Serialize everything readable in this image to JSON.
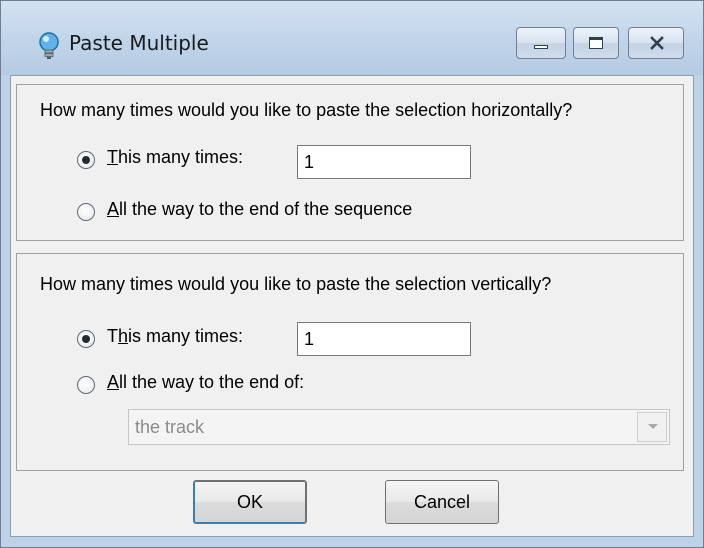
{
  "window": {
    "title": "Paste Multiple",
    "icons": {
      "app": "lightbulb-icon",
      "minimize": "minimize-icon",
      "maximize": "maximize-icon",
      "close": "close-icon"
    }
  },
  "horizontal": {
    "question": "How many times would you like to paste the selection horizontally?",
    "option_count_label": {
      "accel": "T",
      "rest": "his many times:"
    },
    "count_value": "1",
    "option_end_label": {
      "accel": "A",
      "rest": "ll the way to the end of the sequence"
    },
    "selected": "count"
  },
  "vertical": {
    "question": "How many times would you like to paste the selection vertically?",
    "option_count_label": {
      "pre": "T",
      "accel": "h",
      "rest": "is many times:"
    },
    "count_value": "1",
    "option_end_label": {
      "accel": "A",
      "rest": "ll the way to the end of:"
    },
    "end_target_value": "the track",
    "selected": "count"
  },
  "buttons": {
    "ok": "OK",
    "cancel": "Cancel"
  }
}
